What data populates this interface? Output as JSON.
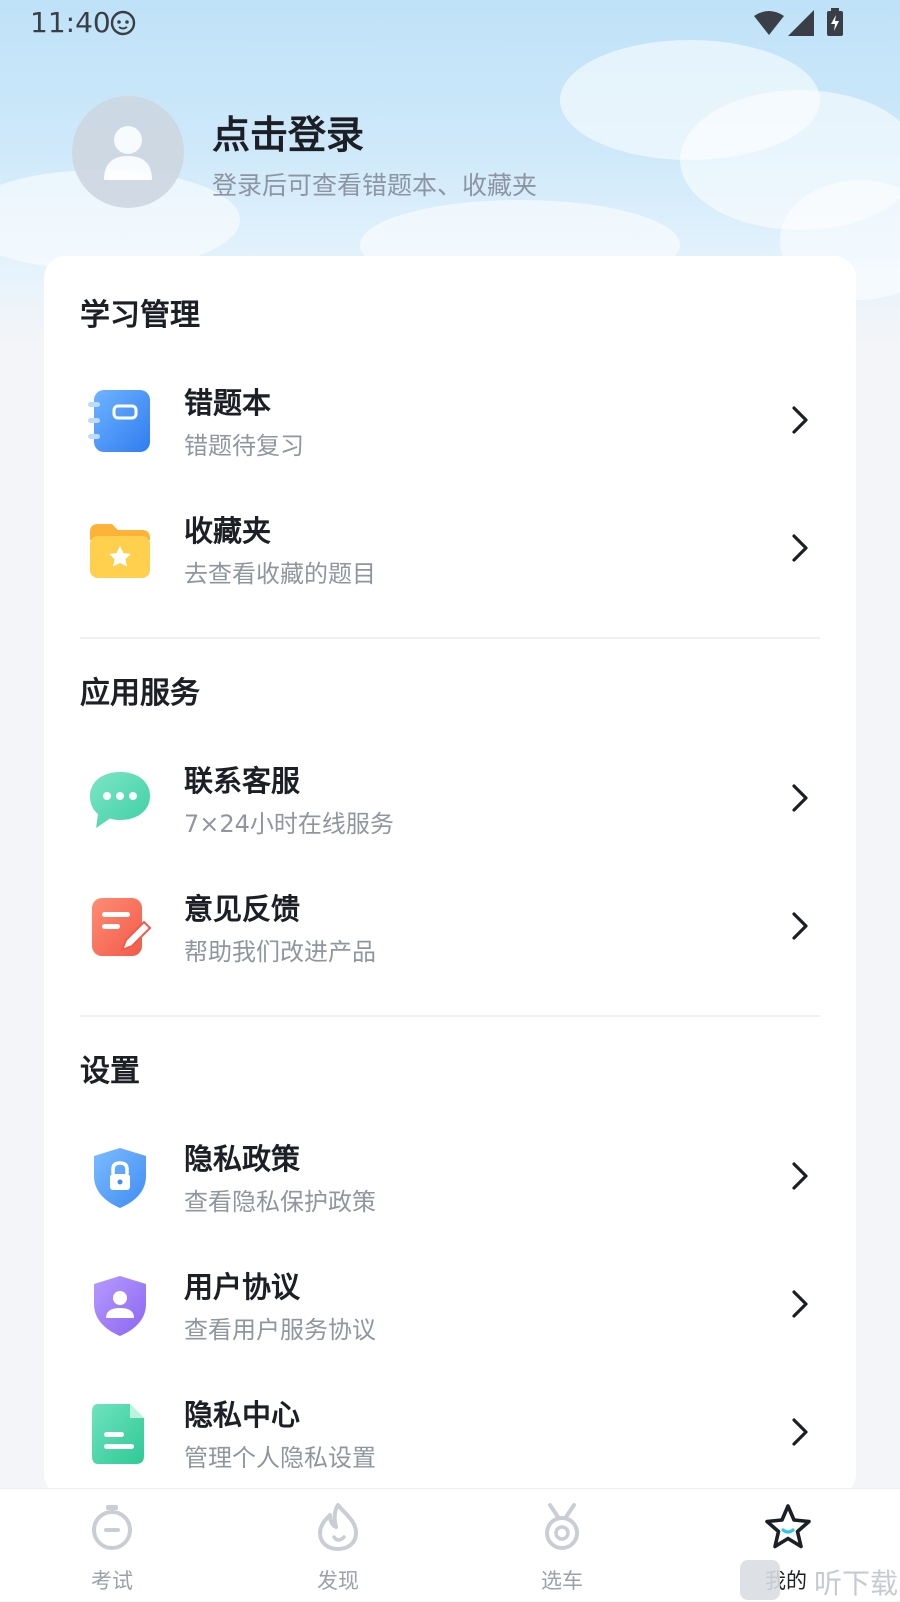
{
  "status_bar": {
    "time": "11:40"
  },
  "profile": {
    "title": "点击登录",
    "subtitle": "登录后可查看错题本、收藏夹"
  },
  "sections": {
    "study": {
      "title": "学习管理",
      "items": [
        {
          "title": "错题本",
          "subtitle": "错题待复习",
          "icon": "notebook-icon"
        },
        {
          "title": "收藏夹",
          "subtitle": "去查看收藏的题目",
          "icon": "star-folder-icon"
        }
      ]
    },
    "services": {
      "title": "应用服务",
      "items": [
        {
          "title": "联系客服",
          "subtitle": "7×24小时在线服务",
          "icon": "chat-bubble-icon"
        },
        {
          "title": "意见反馈",
          "subtitle": "帮助我们改进产品",
          "icon": "feedback-edit-icon"
        }
      ]
    },
    "settings": {
      "title": "设置",
      "items": [
        {
          "title": "隐私政策",
          "subtitle": "查看隐私保护政策",
          "icon": "lock-shield-icon"
        },
        {
          "title": "用户协议",
          "subtitle": "查看用户服务协议",
          "icon": "user-shield-icon"
        },
        {
          "title": "隐私中心",
          "subtitle": "管理个人隐私设置",
          "icon": "document-icon"
        }
      ]
    }
  },
  "tabbar": {
    "tabs": [
      {
        "label": "考试",
        "icon": "stopwatch-icon",
        "active": false
      },
      {
        "label": "发现",
        "icon": "flame-icon",
        "active": false
      },
      {
        "label": "选车",
        "icon": "medal-icon",
        "active": false
      },
      {
        "label": "我的",
        "icon": "star-icon",
        "active": true
      }
    ]
  },
  "watermark": {
    "text": "听下载"
  },
  "colors": {
    "primary_text": "#1c1f26",
    "secondary_text": "#8f96a0",
    "background": "#f3f5f8",
    "sky": "#bfe2f8"
  }
}
